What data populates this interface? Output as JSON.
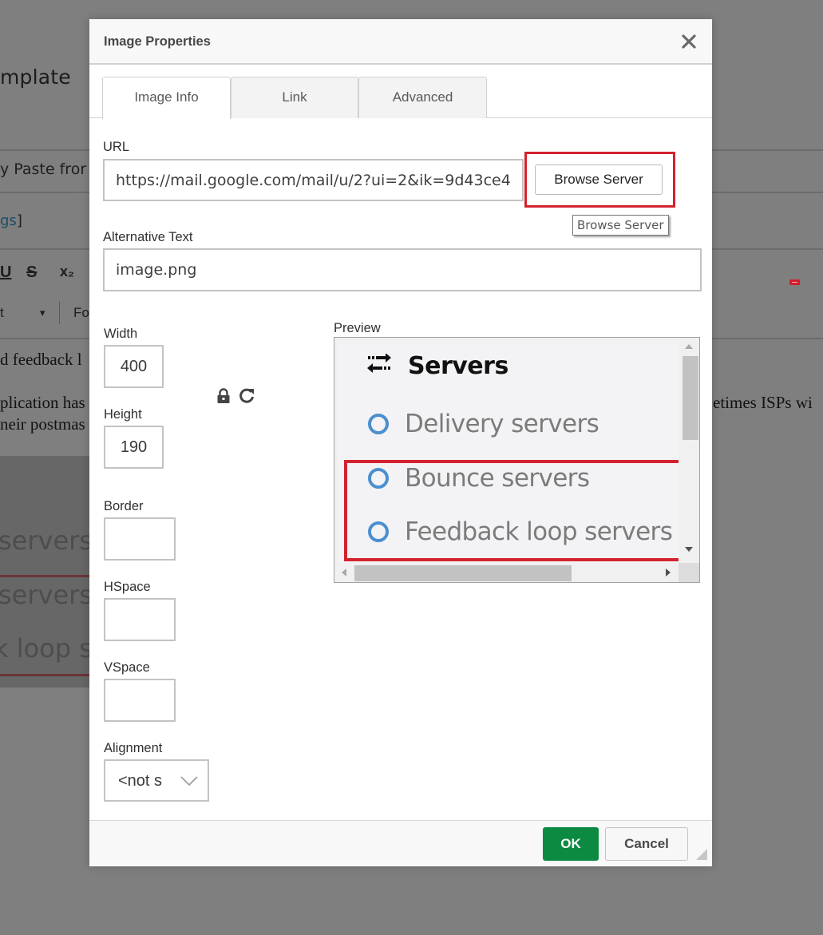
{
  "background_page": {
    "title_fragment": "mplate",
    "paste_fragment": "y Paste fror",
    "tags_fragment": "gs",
    "tags_bracket": "]",
    "toolbar_underline": "U",
    "toolbar_strike": "S",
    "toolbar_subscript": "x₂",
    "format_combo_fragment": "t",
    "format_combo_arrow": "▾",
    "font_combo_fragment": "Fo",
    "body_line1_fragment": "d feedback l",
    "body_line2_fragment": "plication has",
    "body_line2_right_fragment": "etimes ISPs wi",
    "body_line3_fragment": "neir postmas",
    "image_texts": [
      "servers",
      "servers",
      "k loop se"
    ]
  },
  "dialog": {
    "title": "Image Properties",
    "close_label": "×",
    "tabs": [
      {
        "label": "Image Info",
        "active": true
      },
      {
        "label": "Link",
        "active": false
      },
      {
        "label": "Advanced",
        "active": false
      }
    ],
    "url": {
      "label": "URL",
      "value": "https://mail.google.com/mail/u/2?ui=2&ik=9d43ce4"
    },
    "browse_server_label": "Browse Server",
    "browse_server_tooltip": "Browse Server",
    "alt_text": {
      "label": "Alternative Text",
      "value": "image.png"
    },
    "width": {
      "label": "Width",
      "value": "400"
    },
    "height": {
      "label": "Height",
      "value": "190"
    },
    "border": {
      "label": "Border",
      "value": ""
    },
    "hspace": {
      "label": "HSpace",
      "value": ""
    },
    "vspace": {
      "label": "VSpace",
      "value": ""
    },
    "alignment": {
      "label": "Alignment",
      "value": "<not s"
    },
    "preview": {
      "label": "Preview",
      "heading": "Servers",
      "items": [
        "Delivery servers",
        "Bounce servers",
        "Feedback loop servers"
      ]
    },
    "ok_label": "OK",
    "cancel_label": "Cancel"
  },
  "colors": {
    "highlight_red": "#d4222f",
    "ok_green": "#0c8a42",
    "radio_blue": "#4b8fcf",
    "overlay_gray": "#808080"
  }
}
